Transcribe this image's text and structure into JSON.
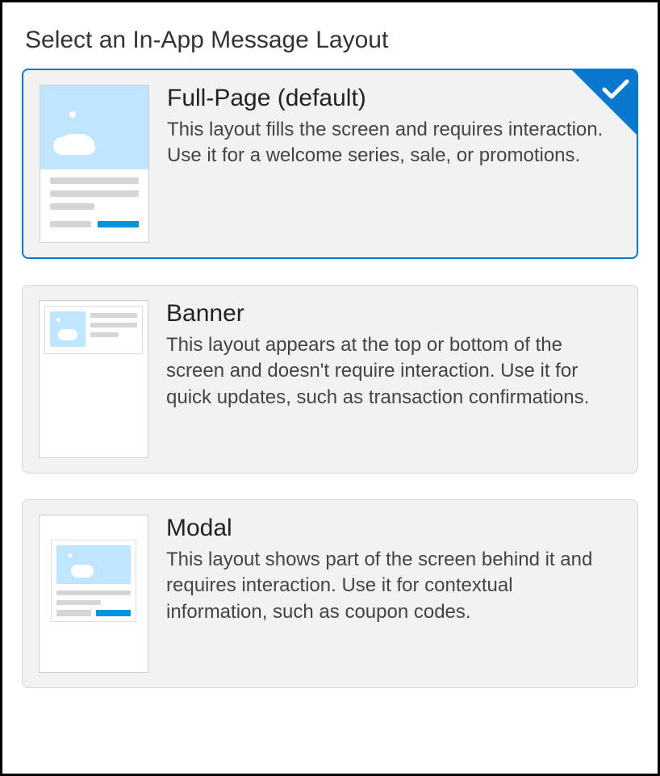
{
  "title": "Select an In-App Message Layout",
  "options": [
    {
      "name": "full-page",
      "title": "Full-Page (default)",
      "description": "This layout fills the screen and requires interaction. Use it for a welcome series, sale, or promotions.",
      "selected": true
    },
    {
      "name": "banner",
      "title": "Banner",
      "description": "This layout appears at the top or bottom of the screen and doesn't require interaction. Use it for quick updates, such as transaction confirmations.",
      "selected": false
    },
    {
      "name": "modal",
      "title": "Modal",
      "description": "This layout shows part of the screen behind it and requires interaction. Use it for contextual information, such as coupon codes.",
      "selected": false
    }
  ]
}
